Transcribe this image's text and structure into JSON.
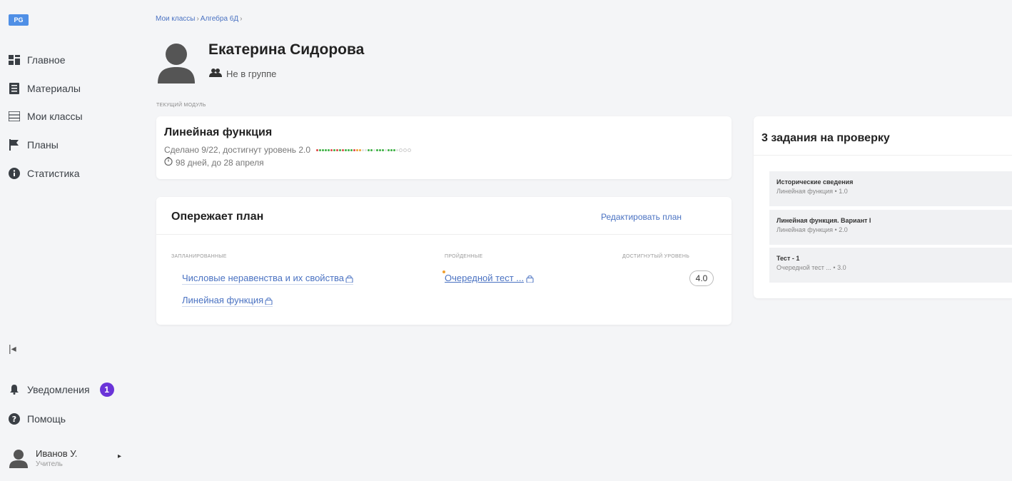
{
  "app": {
    "logo": "PG"
  },
  "sidebar": {
    "items": [
      {
        "label": "Главное",
        "icon": "dashboard-icon"
      },
      {
        "label": "Материалы",
        "icon": "materials-icon"
      },
      {
        "label": "Мои классы",
        "icon": "classes-icon"
      },
      {
        "label": "Планы",
        "icon": "flag-icon"
      },
      {
        "label": "Статистика",
        "icon": "info-icon"
      }
    ],
    "collapse_label": "|◂",
    "notifications": {
      "label": "Уведомления",
      "count": "1"
    },
    "help_label": "Помощь",
    "user": {
      "name": "Иванов У.",
      "role": "Учитель"
    }
  },
  "breadcrumb": [
    "Мои классы",
    "Алгебра 6Д"
  ],
  "student": {
    "name": "Екатерина Сидорова",
    "group_status": "Не в группе"
  },
  "module": {
    "section_label": "ТЕКУЩИЙ МОДУЛЬ",
    "title": "Линейная функция",
    "progress_text": "Сделано 9/22, достигнут уровень 2.0",
    "deadline": "98 дней, до 28 апреля",
    "progress_dots": [
      "#e04848",
      "#3cb043",
      "#3cb043",
      "#3cb043",
      "#3cb043",
      "#e04848",
      "#3cb043",
      "#e04848",
      "#3cb043",
      "#e04848",
      "#3cb043",
      "#3cb043",
      "#3cb043",
      "#e04848",
      "#f0a030",
      "#f0a030",
      "#e0e0e0",
      "#e0e0e0",
      "#3cb043",
      "#3cb043",
      "#e0e0e0",
      "#3cb043",
      "#3cb043",
      "#3cb043",
      "#e0e0e0",
      "#3cb043",
      "#3cb043",
      "#3cb043",
      "#e0e0e0",
      "empty",
      "empty",
      "empty"
    ]
  },
  "plan": {
    "title": "Опережает план",
    "edit_label": "Редактировать план",
    "col_planned": "ЗАПЛАНИРОВАННЫЕ",
    "col_passed": "ПРОЙДЕННЫЕ",
    "col_level": "ДОСТИГНУТЫЙ УРОВЕНЬ",
    "planned": [
      "Числовые неравенства и их свойства",
      "Линейная функция"
    ],
    "passed": "Очередной тест ...",
    "level": "4.0"
  },
  "review": {
    "title": "3 задания на проверку",
    "items": [
      {
        "title": "Исторические сведения",
        "sub": "Линейная функция • 1.0"
      },
      {
        "title": "Линейная функция. Вариант I",
        "sub": "Линейная функция • 2.0"
      },
      {
        "title": "Тест - 1",
        "sub": "Очередной тест ... • 3.0"
      }
    ]
  },
  "colors": {
    "accent": "#4a72c2",
    "badge": "#6a34d8",
    "logo": "#4f8fe6"
  }
}
